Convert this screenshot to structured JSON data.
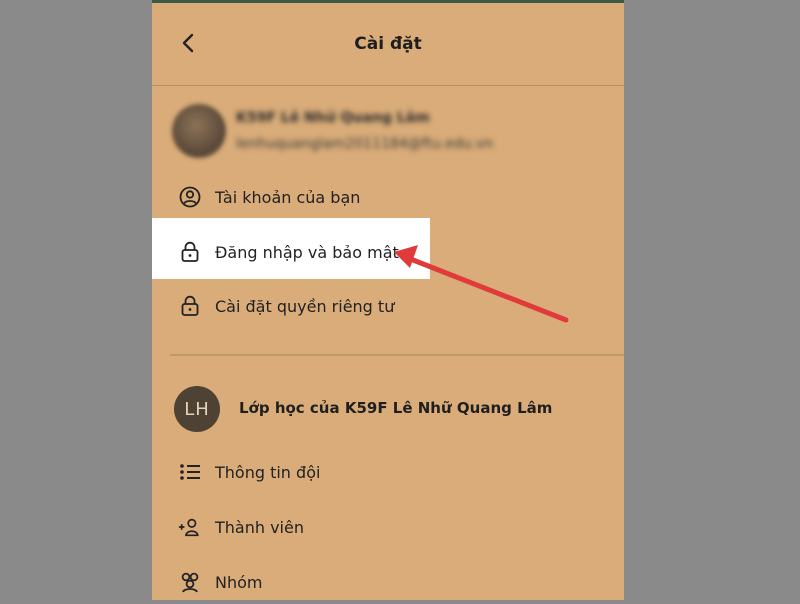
{
  "header": {
    "title": "Cài đặt",
    "back_icon": "chevron-left-icon"
  },
  "profile": {
    "name": "K59F Lê Nhữ Quang Lâm",
    "email": "lenhuquanglam2011184@ftu.edu.vn"
  },
  "account_menu": [
    {
      "label": "Tài khoản của bạn",
      "icon": "user-circle-icon"
    },
    {
      "label": "Đăng nhập và bảo mật",
      "icon": "lock-icon",
      "highlighted": true
    },
    {
      "label": "Cài đặt quyền riêng tư",
      "icon": "lock-icon"
    }
  ],
  "team": {
    "initials": "LH",
    "name": "Lớp học của K59F Lê Nhữ Quang Lâm"
  },
  "team_menu": [
    {
      "label": "Thông tin đội",
      "icon": "list-icon"
    },
    {
      "label": "Thành viên",
      "icon": "add-user-icon"
    },
    {
      "label": "Nhóm",
      "icon": "group-icon"
    }
  ],
  "annotation": {
    "color": "#e03a3a",
    "icon": "red-arrow"
  },
  "colors": {
    "panel": "#d9ac79",
    "backdrop": "#8a8a8a",
    "highlight": "#ffffff"
  }
}
